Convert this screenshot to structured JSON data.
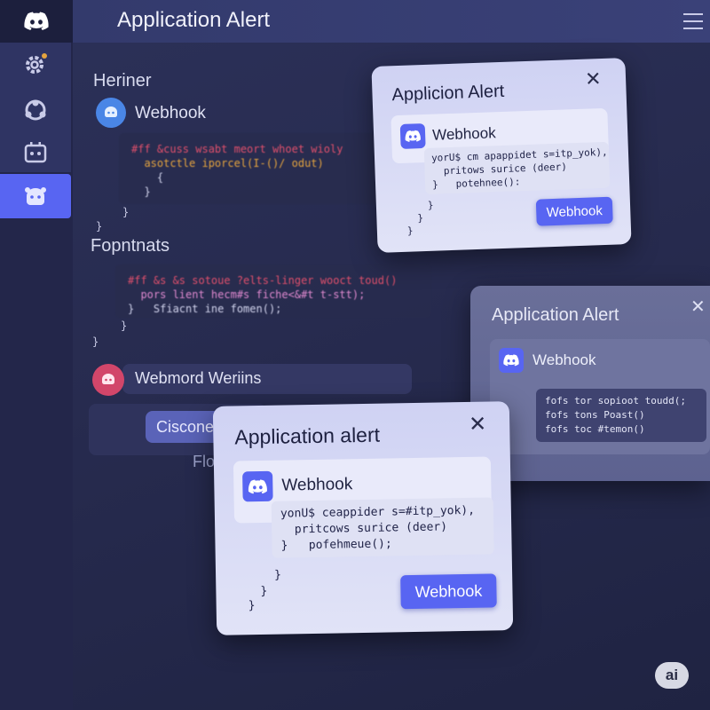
{
  "header": {
    "title": "Application Alert"
  },
  "sidebar": {
    "logo": "discord-logo-icon",
    "items": [
      {
        "icon": "gear-icon"
      },
      {
        "icon": "community-icon"
      },
      {
        "icon": "bot-icon"
      },
      {
        "icon": "bot-avatar-icon",
        "active": true
      }
    ]
  },
  "background": {
    "section1_label": "Heriner",
    "section1_row": "Webhook",
    "section1_code": [
      "#ff &cuss wsabt meort whoet wioly",
      "  asotctle iporcel(I-()/ odut)",
      "    {",
      "  }"
    ],
    "section1_closing": "}",
    "section2_label": "Fopntnats",
    "section2_code": [
      "#ff &s &s sotoue ?elts-linger wooct toud()",
      "  pors lient hecm#s fiche<&#t t-stt);",
      "}   Sfiacnt ine fomen();"
    ],
    "section2_closing": "}",
    "section2_closing2": "}",
    "section3_row": "Webmord Weriins",
    "cisco_button": "Ciscone",
    "flo_text": "Flo"
  },
  "dialogs": [
    {
      "id": "top",
      "title": "Applicion Alert",
      "close": "✕",
      "webhook_label": "Webhook",
      "code": [
        "yorU$ cm apappidet s=itp_yok),",
        "  pritows surice (deer)",
        "}   potehnee():"
      ],
      "braces": [
        "}",
        "}",
        "}"
      ],
      "button": "Webhook"
    },
    {
      "id": "right",
      "title": "Application Alert",
      "close": "✕",
      "webhook_label": "Webhook",
      "code": [
        "fofs tor sopioot toudd(;",
        "fofs tons Poast()",
        "fofs toc #temon()"
      ]
    },
    {
      "id": "front",
      "title": "Application alert",
      "close": "✕",
      "webhook_label": "Webhook",
      "code": [
        "yonU$ ceappider s=#itp_yok),",
        "  pritcows surice (deer)",
        "}   pofehmeue();"
      ],
      "braces": [
        "}",
        "}",
        "}"
      ],
      "button": "Webhook"
    }
  ],
  "badge": "ai",
  "colors": {
    "accent": "#5865f2",
    "sidebar": "#23264a",
    "header": "#373e73",
    "keyword": "#e0506c",
    "function": "#e5a43f"
  }
}
